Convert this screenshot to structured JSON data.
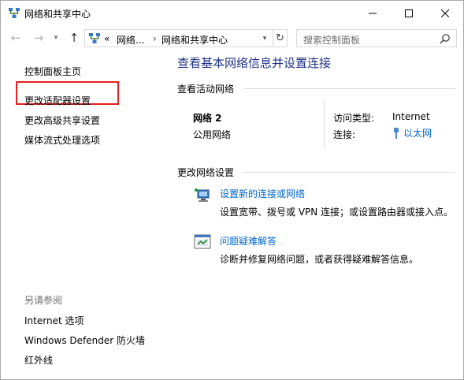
{
  "window": {
    "title": "网络和共享中心",
    "controls": {
      "minimize": "minimize",
      "maximize": "maximize",
      "close": "close"
    }
  },
  "address_bar": {
    "prefix": "«",
    "crumb1": "网络...",
    "separator": "›",
    "crumb2": "网络和共享中心",
    "search_placeholder": "搜索控制面板"
  },
  "left_pane": {
    "home": "控制面板主页",
    "items": [
      "更改适配器设置",
      "更改高级共享设置",
      "媒体流式处理选项"
    ],
    "see_also_title": "另请参阅",
    "see_also": [
      "Internet 选项",
      "Windows Defender 防火墙",
      "红外线"
    ],
    "highlight_color": "#e52020"
  },
  "main": {
    "title": "查看基本网络信息并设置连接",
    "active_networks_title": "查看活动网络",
    "network": {
      "name": "网络 2",
      "category": "公用网络",
      "access_type_label": "访问类型:",
      "access_type_value": "Internet",
      "connections_label": "连接:",
      "connection_value": "以太网"
    },
    "change_settings_title": "更改网络设置",
    "tasks": [
      {
        "icon": "new-connection-icon",
        "link": "设置新的连接或网络",
        "desc": "设置宽带、拨号或 VPN 连接；或设置路由器或接入点。"
      },
      {
        "icon": "troubleshoot-icon",
        "link": "问题疑难解答",
        "desc": "诊断并修复网络问题，或者获得疑难解答信息。"
      }
    ]
  },
  "colors": {
    "link": "#0066cc",
    "title": "#1e3287",
    "muted": "#6d6d6d"
  }
}
